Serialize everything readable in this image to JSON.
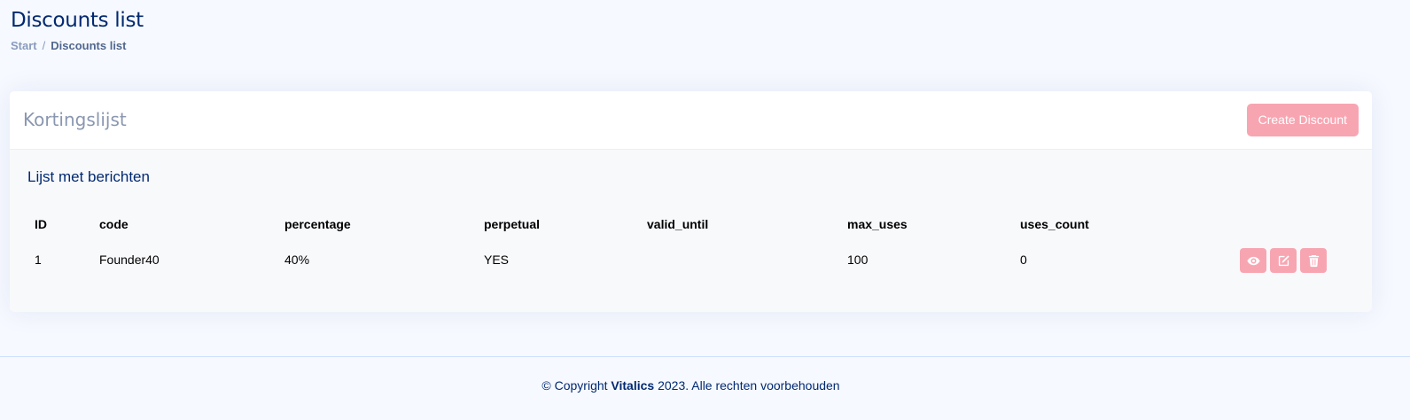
{
  "page": {
    "title": "Discounts list",
    "breadcrumb": {
      "start": "Start",
      "separator": "/",
      "current": "Discounts list"
    }
  },
  "card": {
    "title": "Kortingslijst",
    "create_button": "Create Discount",
    "section_title": "Lijst met berichten"
  },
  "table": {
    "columns": [
      "ID",
      "code",
      "percentage",
      "perpetual",
      "valid_until",
      "max_uses",
      "uses_count"
    ],
    "rows": [
      [
        "1",
        "Founder40",
        "40%",
        "YES",
        "",
        "100",
        "0"
      ]
    ],
    "actions": [
      "eye-icon",
      "edit-icon",
      "trash-icon"
    ]
  },
  "footer": {
    "prefix": "© Copyright ",
    "brand": "Vitalics",
    "suffix": " 2023. Alle rechten voorbehouden"
  },
  "colors": {
    "accent": "#f8a5b2",
    "primary_text": "#012970",
    "background": "#f6f9ff"
  }
}
